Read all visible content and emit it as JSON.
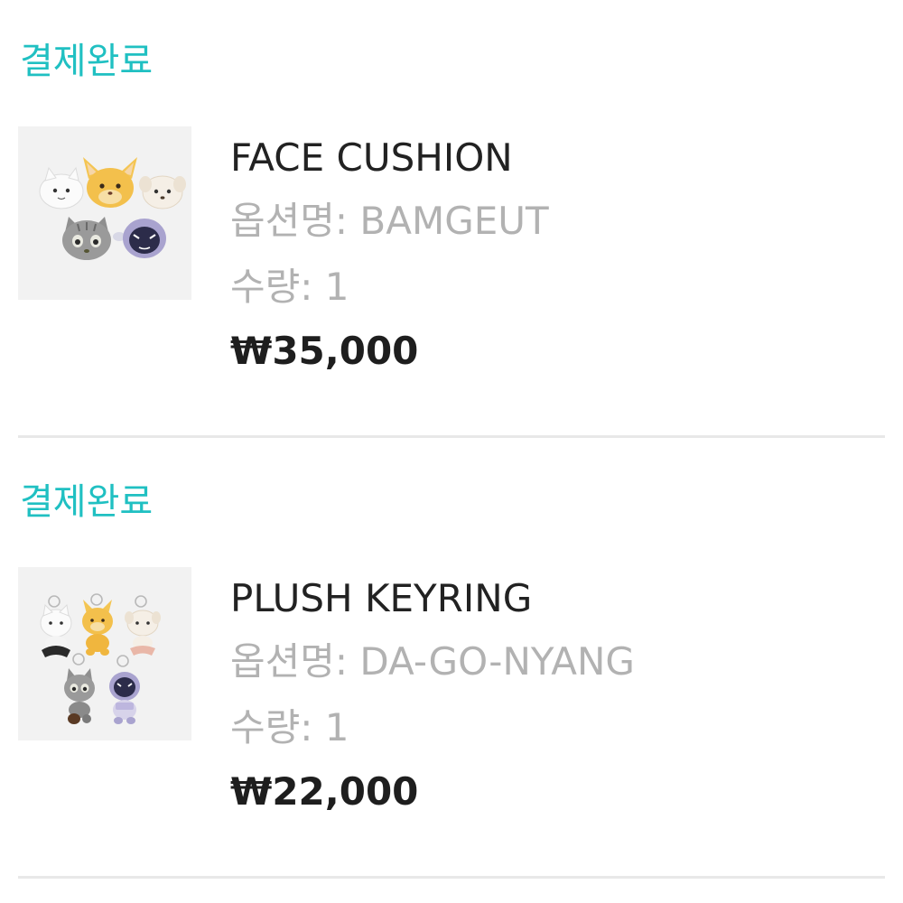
{
  "orders": [
    {
      "status": "결제완료",
      "product_name": "FACE CUSHION",
      "option_label": "옵션명: ",
      "option_value": "BAMGEUT",
      "qty_label": "수량: ",
      "qty_value": "1",
      "price": "₩35,000",
      "thumbnail": "face-cushion-product-photo"
    },
    {
      "status": "결제완료",
      "product_name": "PLUSH KEYRING",
      "option_label": "옵션명: ",
      "option_value": "DA-GO-NYANG",
      "qty_label": "수량: ",
      "qty_value": "1",
      "price": "₩22,000",
      "thumbnail": "plush-keyring-product-photo"
    }
  ],
  "colors": {
    "status": "#20c0c2",
    "name": "#222222",
    "muted": "#b2b2b2",
    "price": "#1e1e1e",
    "divider": "#e8e8e8",
    "thumb_bg": "#f2f2f2"
  }
}
